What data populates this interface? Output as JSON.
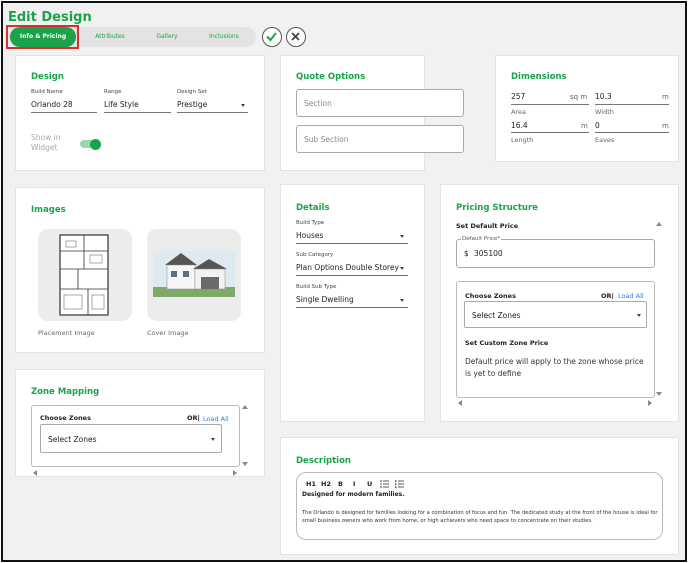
{
  "page_title": "Edit Design",
  "tabs": [
    {
      "label": "Info & Pricing",
      "active": true
    },
    {
      "label": "Attributes"
    },
    {
      "label": "Gallery"
    },
    {
      "label": "Inclusions"
    }
  ],
  "actions": {
    "confirm_icon": "check-icon",
    "cancel_icon": "close-icon"
  },
  "colors": {
    "accent": "#1aa34a",
    "highlight": "#d83030",
    "link": "#2a7be0"
  },
  "design": {
    "title": "Design",
    "build_name_label": "Build Name",
    "build_name": "Orlando 28",
    "range_label": "Range",
    "range": "Life Style",
    "design_set_label": "Design Set",
    "design_set": "Prestige",
    "widget_label": "Show in Widget",
    "widget_on": true
  },
  "quote_options": {
    "title": "Quote Options",
    "section_placeholder": "Section",
    "sub_section_placeholder": "Sub Section"
  },
  "dimensions": {
    "title": "Dimensions",
    "area_value": "257",
    "area_unit": "sq m",
    "area_label": "Area",
    "width_value": "10.3",
    "width_unit": "m",
    "width_label": "Width",
    "length_value": "16.4",
    "length_unit": "m",
    "length_label": "Length",
    "eaves_value": "0",
    "eaves_unit": "m",
    "eaves_label": "Eaves"
  },
  "images": {
    "title": "Images",
    "placement_label": "Placement Image",
    "cover_label": "Cover Image"
  },
  "details": {
    "title": "Details",
    "build_type_label": "Build Type",
    "build_type": "Houses",
    "sub_category_label": "Sub Category",
    "sub_category": "Plan Options Double Storey",
    "build_sub_type_label": "Build Sub Type",
    "build_sub_type": "Single Dwelling"
  },
  "pricing": {
    "title": "Pricing Structure",
    "set_default_label": "Set Default Price",
    "default_price_label": "Default Price*",
    "currency": "$",
    "default_price": "305100",
    "choose_zones": "Choose Zones",
    "or": "OR|",
    "load_all": "Load All",
    "select_zones": "Select Zones",
    "custom_zone_label": "Set Custom Zone Price",
    "custom_zone_text": "Default price will apply to the zone whose price is yet to define"
  },
  "zone_mapping": {
    "title": "Zone Mapping",
    "choose_zones": "Choose Zones",
    "or": "OR|",
    "load_all": "Load All",
    "select_zones": "Select Zones"
  },
  "description": {
    "title": "Description",
    "toolbar": [
      "H1",
      "H2",
      "B",
      "I",
      "U"
    ],
    "heading": "Designed for modern families.",
    "body": "The Orlando is designed for families looking for a combination of focus and fun. The dedicated study at the front of the house is ideal for small business owners who work from home, or high achievers who need space to concentrate on their studies."
  }
}
